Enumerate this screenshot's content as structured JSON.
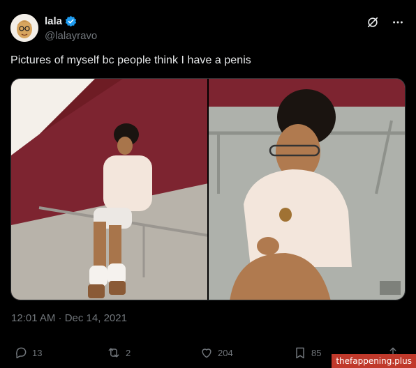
{
  "user": {
    "display_name": "lala",
    "handle": "@lalayravo",
    "avatar_icon": "cartoon-avatar-icon",
    "verified_icon": "verified-badge-icon",
    "verified_color": "#1d9bf0"
  },
  "header": {
    "grok_icon": "grok-icon",
    "more_icon": "more-horizontal-icon"
  },
  "tweet": {
    "text": "Pictures of myself bc people think I have a penis",
    "timestamp": "12:01 AM · Dec 14, 2021"
  },
  "media": {
    "count": 2
  },
  "actions": {
    "replies": "13",
    "reposts": "2",
    "likes": "204",
    "bookmarks": "85",
    "share_icon": "share-icon"
  },
  "watermark": "thefappening.plus",
  "colors": {
    "background": "#000000",
    "text_primary": "#e7e9ea",
    "text_secondary": "#71767b",
    "border": "#2f3336",
    "watermark_bg": "#c0392b"
  }
}
